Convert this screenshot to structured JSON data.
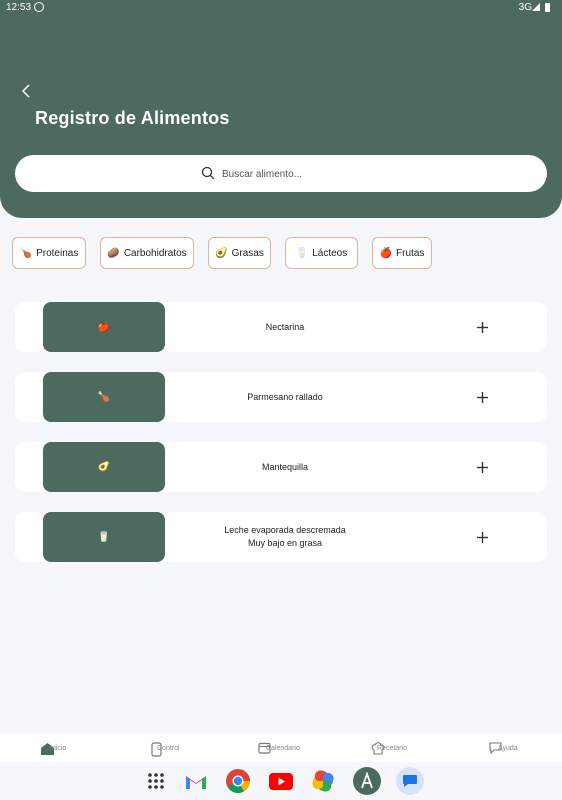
{
  "status_bar": {
    "time": "12:53",
    "network": "3G"
  },
  "header": {
    "title": "Registro de Alimentos"
  },
  "search": {
    "placeholder": "Buscar alimento..."
  },
  "categories": [
    {
      "emoji": "🍗",
      "label": "Proteinas"
    },
    {
      "emoji": "🥔",
      "label": "Carbohidratos"
    },
    {
      "emoji": "🥑",
      "label": "Grasas"
    },
    {
      "emoji": "🥛",
      "label": "Lácteos"
    },
    {
      "emoji": "🍎",
      "label": "Frutas"
    }
  ],
  "foods": [
    {
      "emoji": "🍎",
      "name": "Nectarina",
      "note": ""
    },
    {
      "emoji": "🍗",
      "name": "Parmesano rallado",
      "note": ""
    },
    {
      "emoji": "🥑",
      "name": "Mantequilla",
      "note": ""
    },
    {
      "emoji": "🥛",
      "name": "Leche evaporada descremada",
      "note": "Muy bajo en grasa"
    }
  ],
  "bottom_nav": [
    {
      "label": "Inicio",
      "icon": "home-icon"
    },
    {
      "label": "Control",
      "icon": "phone-icon"
    },
    {
      "label": "Calendario",
      "icon": "calendar-icon"
    },
    {
      "label": "Recetario",
      "icon": "chef-hat-icon"
    },
    {
      "label": "Ayuda",
      "icon": "chat-icon"
    }
  ],
  "dock": [
    "apps-grid-icon",
    "gmail-icon",
    "chrome-icon",
    "youtube-icon",
    "photos-icon",
    "app-icon",
    "messages-icon"
  ],
  "colors": {
    "primary": "#4d6a5f",
    "chip_border": "#e2b39b",
    "background": "#f6f7fb"
  }
}
